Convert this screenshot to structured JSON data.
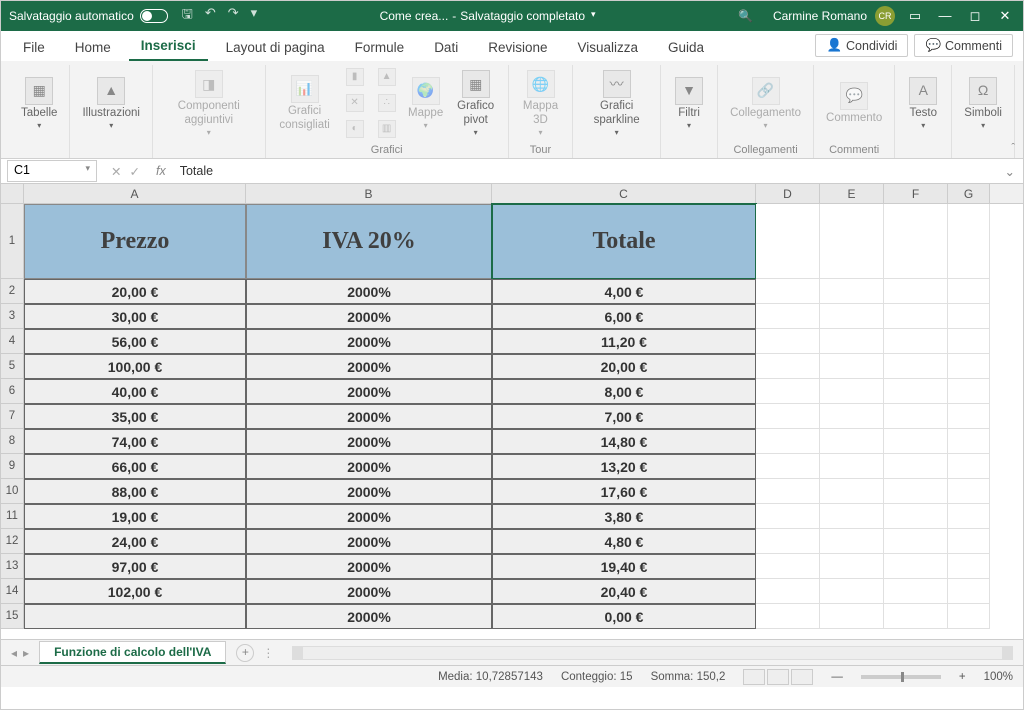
{
  "titlebar": {
    "autosave_label": "Salvataggio automatico",
    "doc_name": "Come crea...",
    "save_status": "Salvataggio completato",
    "user_name": "Carmine Romano",
    "user_initials": "CR"
  },
  "tabs": {
    "file": "File",
    "home": "Home",
    "inserisci": "Inserisci",
    "layout": "Layout di pagina",
    "formule": "Formule",
    "dati": "Dati",
    "revisione": "Revisione",
    "visualizza": "Visualizza",
    "guida": "Guida",
    "condividi": "Condividi",
    "commenti": "Commenti"
  },
  "ribbon": {
    "tabelle": "Tabelle",
    "illustrazioni": "Illustrazioni",
    "componenti": "Componenti aggiuntivi",
    "grafici_cons": "Grafici consigliati",
    "mappe": "Mappe",
    "grafico_pivot": "Grafico pivot",
    "mappa3d": "Mappa 3D",
    "sparkline": "Grafici sparkline",
    "filtri": "Filtri",
    "collegamento": "Collegamento",
    "commento": "Commento",
    "testo": "Testo",
    "simboli": "Simboli",
    "g_grafici": "Grafici",
    "g_tour": "Tour",
    "g_collegamenti": "Collegamenti",
    "g_commenti": "Commenti"
  },
  "formula": {
    "cell_ref": "C1",
    "value": "Totale"
  },
  "columns": [
    "A",
    "B",
    "C",
    "D",
    "E",
    "F",
    "G"
  ],
  "headers": {
    "a": "Prezzo",
    "b": "IVA 20%",
    "c": "Totale"
  },
  "rows": [
    {
      "n": "2",
      "a": "20,00 €",
      "b": "2000%",
      "c": "4,00 €"
    },
    {
      "n": "3",
      "a": "30,00 €",
      "b": "2000%",
      "c": "6,00 €"
    },
    {
      "n": "4",
      "a": "56,00 €",
      "b": "2000%",
      "c": "11,20 €"
    },
    {
      "n": "5",
      "a": "100,00 €",
      "b": "2000%",
      "c": "20,00 €"
    },
    {
      "n": "6",
      "a": "40,00 €",
      "b": "2000%",
      "c": "8,00 €"
    },
    {
      "n": "7",
      "a": "35,00 €",
      "b": "2000%",
      "c": "7,00 €"
    },
    {
      "n": "8",
      "a": "74,00 €",
      "b": "2000%",
      "c": "14,80 €"
    },
    {
      "n": "9",
      "a": "66,00 €",
      "b": "2000%",
      "c": "13,20 €"
    },
    {
      "n": "10",
      "a": "88,00 €",
      "b": "2000%",
      "c": "17,60 €"
    },
    {
      "n": "11",
      "a": "19,00 €",
      "b": "2000%",
      "c": "3,80 €"
    },
    {
      "n": "12",
      "a": "24,00 €",
      "b": "2000%",
      "c": "4,80 €"
    },
    {
      "n": "13",
      "a": "97,00 €",
      "b": "2000%",
      "c": "19,40 €"
    },
    {
      "n": "14",
      "a": "102,00 €",
      "b": "2000%",
      "c": "20,40 €"
    },
    {
      "n": "15",
      "a": "",
      "b": "2000%",
      "c": "0,00 €"
    }
  ],
  "sheet": {
    "name": "Funzione di calcolo dell'IVA"
  },
  "status": {
    "media": "Media: 10,72857143",
    "conteggio": "Conteggio: 15",
    "somma": "Somma: 150,2",
    "zoom": "100%"
  }
}
